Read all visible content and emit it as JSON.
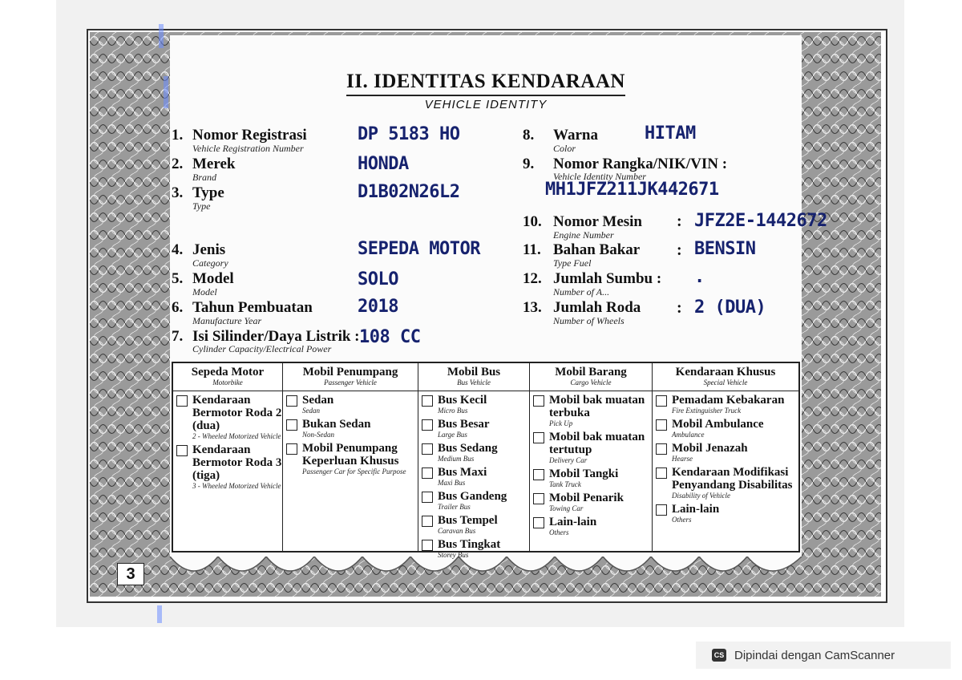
{
  "page": {
    "title": "II. IDENTITAS KENDARAAN",
    "subtitle": "VEHICLE IDENTITY",
    "page_number": "3"
  },
  "fields": [
    {
      "num": "1.",
      "label": "Nomor Registrasi",
      "sub": "Vehicle Registration Number",
      "colon": "",
      "value": "DP 5183 HO"
    },
    {
      "num": "2.",
      "label": "Merek",
      "sub": "Brand",
      "colon": "",
      "value": "HONDA"
    },
    {
      "num": "3.",
      "label": "Type",
      "sub": "Type",
      "colon": "",
      "value": "D1B02N26L2"
    },
    {
      "num": "4.",
      "label": "Jenis",
      "sub": "Category",
      "colon": "",
      "value": "SEPEDA MOTOR"
    },
    {
      "num": "5.",
      "label": "Model",
      "sub": "Model",
      "colon": "",
      "value": "SOLO"
    },
    {
      "num": "6.",
      "label": "Tahun Pembuatan",
      "sub": "Manufacture Year",
      "colon": "",
      "value": "2018"
    },
    {
      "num": "7.",
      "label": "Isi Silinder/Daya Listrik :",
      "sub": "Cylinder Capacity/Electrical Power",
      "colon": "",
      "value": "108 CC"
    },
    {
      "num": "8.",
      "label": "Warna",
      "sub": "Color",
      "colon": "",
      "value": "HITAM"
    },
    {
      "num": "9.",
      "label": "Nomor Rangka/NIK/VIN :",
      "sub": "Vehicle Identity Number",
      "colon": "",
      "value": "MH1JFZ211JK442671"
    },
    {
      "num": "10.",
      "label": "Nomor Mesin",
      "sub": "Engine Number",
      "colon": ":",
      "value": "JFZ2E-1442672"
    },
    {
      "num": "11.",
      "label": "Bahan Bakar",
      "sub": "Type Fuel",
      "colon": ":",
      "value": "BENSIN"
    },
    {
      "num": "12.",
      "label": "Jumlah Sumbu :",
      "sub": "Number of A...",
      "colon": "",
      "value": "."
    },
    {
      "num": "13.",
      "label": "Jumlah Roda",
      "sub": "Number of Wheels",
      "colon": ":",
      "value": "2 (DUA)"
    }
  ],
  "table": {
    "columns": [
      {
        "title": "Sepeda Motor",
        "sub": "Motorbike",
        "items": [
          {
            "label": "Kendaraan Bermotor Roda 2 (dua)",
            "sub": "2 - Wheeled Motorized Vehicle"
          },
          {
            "label": "Kendaraan Bermotor Roda 3 (tiga)",
            "sub": "3 - Wheeled Motorized Vehicle"
          }
        ]
      },
      {
        "title": "Mobil Penumpang",
        "sub": "Passenger Vehicle",
        "items": [
          {
            "label": "Sedan",
            "sub": "Sedan"
          },
          {
            "label": "Bukan Sedan",
            "sub": "Non-Sedan"
          },
          {
            "label": "Mobil Penumpang Keperluan Khusus",
            "sub": "Passenger Car for Specific Purpose"
          }
        ]
      },
      {
        "title": "Mobil Bus",
        "sub": "Bus Vehicle",
        "items": [
          {
            "label": "Bus Kecil",
            "sub": "Micro Bus"
          },
          {
            "label": "Bus Besar",
            "sub": "Large Bus"
          },
          {
            "label": "Bus Sedang",
            "sub": "Medium Bus"
          },
          {
            "label": "Bus Maxi",
            "sub": "Maxi Bus"
          },
          {
            "label": "Bus Gandeng",
            "sub": "Trailer Bus"
          },
          {
            "label": "Bus Tempel",
            "sub": "Caravan Bus"
          },
          {
            "label": "Bus Tingkat",
            "sub": "Storey Bus"
          }
        ]
      },
      {
        "title": "Mobil Barang",
        "sub": "Cargo Vehicle",
        "items": [
          {
            "label": "Mobil bak muatan terbuka",
            "sub": "Pick Up"
          },
          {
            "label": "Mobil bak muatan tertutup",
            "sub": "Delivery Car"
          },
          {
            "label": "Mobil Tangki",
            "sub": "Tank Truck"
          },
          {
            "label": "Mobil Penarik",
            "sub": "Towing Car"
          },
          {
            "label": "Lain-lain",
            "sub": "Others"
          }
        ]
      },
      {
        "title": "Kendaraan Khusus",
        "sub": "Special Vehicle",
        "items": [
          {
            "label": "Pemadam Kebakaran",
            "sub": "Fire Extinguisher Truck"
          },
          {
            "label": "Mobil Ambulance",
            "sub": "Ambulance"
          },
          {
            "label": "Mobil Jenazah",
            "sub": "Hearse"
          },
          {
            "label": "Kendaraan Modifikasi Penyandang Disabilitas",
            "sub": "Disability of Vehicle"
          },
          {
            "label": "Lain-lain",
            "sub": "Others"
          }
        ]
      }
    ]
  },
  "watermark": {
    "logo": "CS",
    "text": "Dipindai dengan CamScanner"
  },
  "colors": {
    "handwriting": "#16226e",
    "frame": "#333333"
  }
}
